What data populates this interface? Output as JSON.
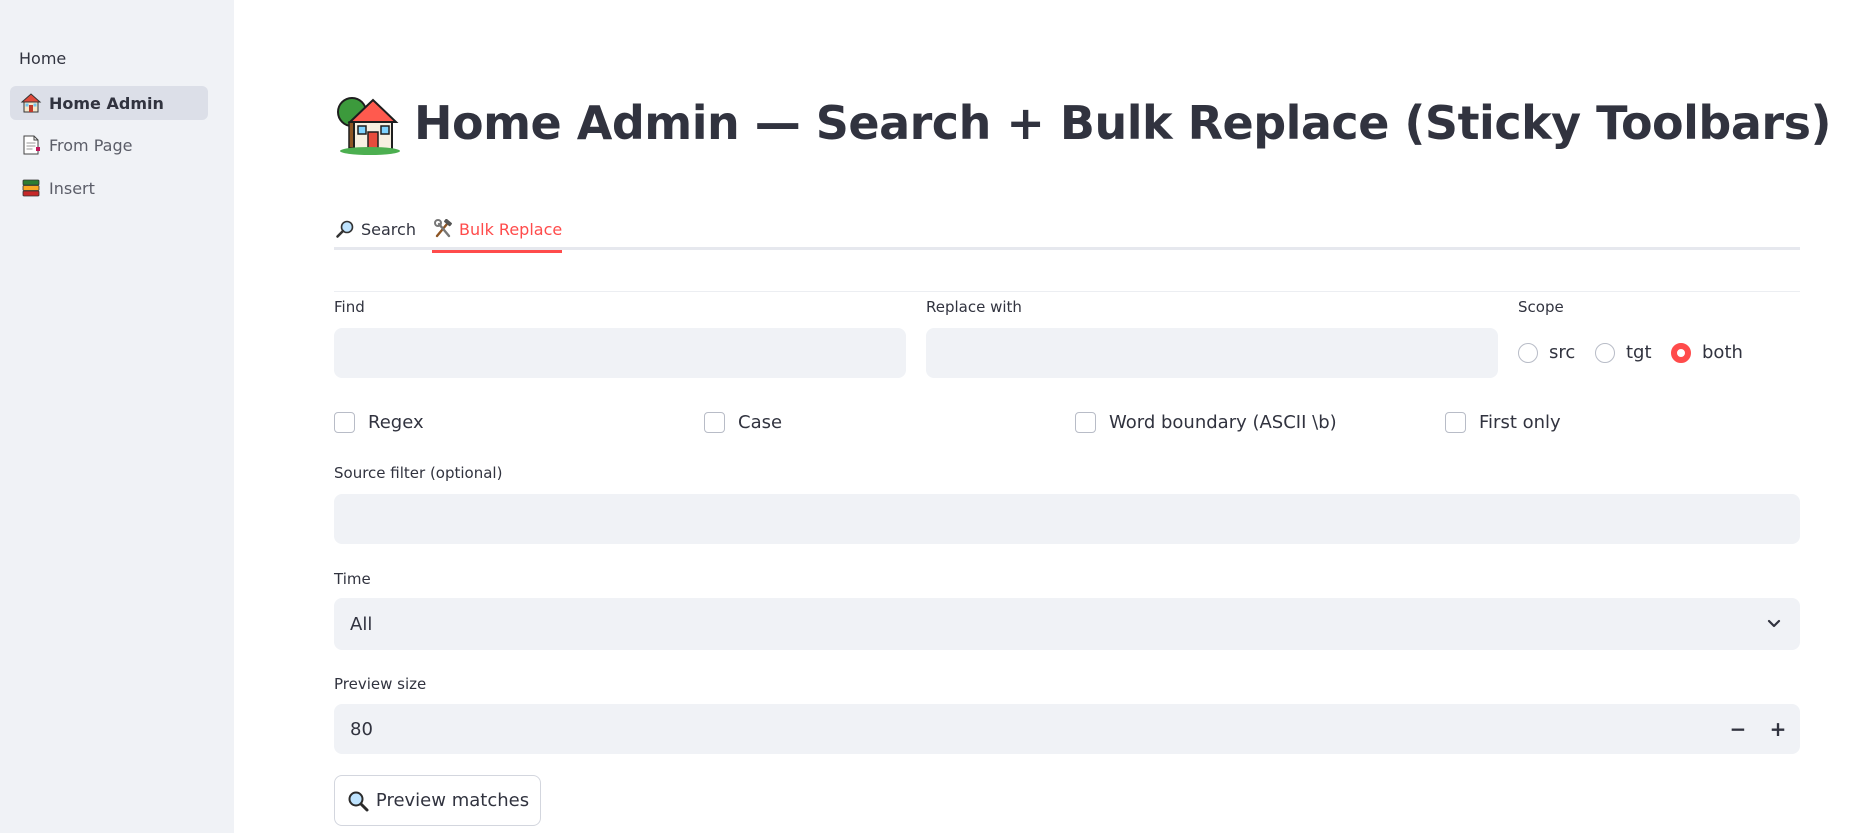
{
  "sidebar": {
    "home_label": "Home",
    "items": [
      {
        "label": "Home Admin",
        "icon": "house-icon",
        "active": true
      },
      {
        "label": "From Page",
        "icon": "page-icon",
        "active": false
      },
      {
        "label": "Insert",
        "icon": "books-icon",
        "active": false
      }
    ]
  },
  "header": {
    "title": "Home Admin — Search + Bulk Replace (Sticky Toolbars)",
    "icon": "house-with-garden-icon"
  },
  "tabs": [
    {
      "label": "Search",
      "icon": "magnifier-icon",
      "active": false
    },
    {
      "label": "Bulk Replace",
      "icon": "hammer-wrench-icon",
      "active": true
    }
  ],
  "form": {
    "find_label": "Find",
    "find_value": "",
    "replace_label": "Replace with",
    "replace_value": "",
    "scope_label": "Scope",
    "scope_options": [
      "src",
      "tgt",
      "both"
    ],
    "scope_selected": "both",
    "checkboxes": [
      {
        "label": "Regex",
        "checked": false
      },
      {
        "label": "Case",
        "checked": false
      },
      {
        "label": "Word boundary (ASCII \\b)",
        "checked": false
      },
      {
        "label": "First only",
        "checked": false
      }
    ],
    "source_filter_label": "Source filter (optional)",
    "source_filter_value": "",
    "time_label": "Time",
    "time_selected": "All",
    "preview_size_label": "Preview size",
    "preview_size_value": "80",
    "decrement_label": "−",
    "increment_label": "+",
    "preview_button_label": "Preview matches"
  },
  "colors": {
    "accent": "#ff4b4b",
    "sidebar_bg": "#f0f2f6",
    "input_bg": "#f0f2f6",
    "text": "#31333f"
  }
}
